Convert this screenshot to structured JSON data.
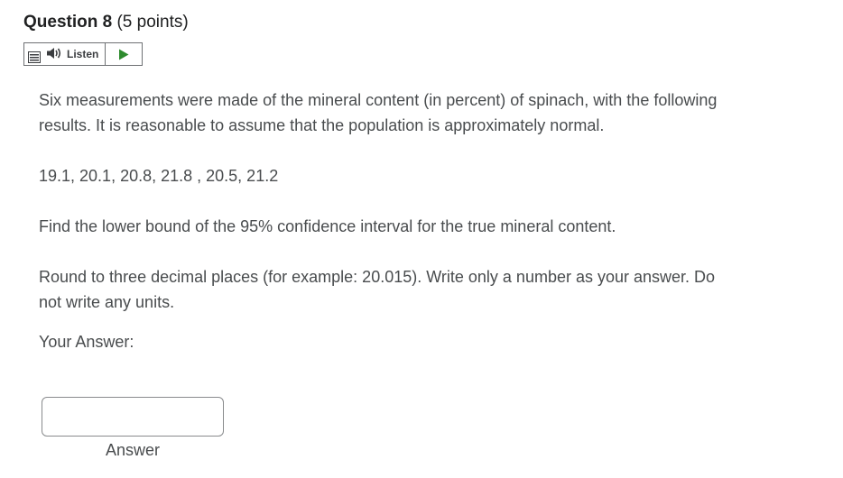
{
  "question": {
    "title": "Question 8",
    "points": "(5 points)"
  },
  "listen": {
    "label": "Listen",
    "icons": [
      "menu-icon",
      "speaker-icon",
      "play-icon"
    ],
    "play_color": "#2e8b2e"
  },
  "body": {
    "intro": "Six measurements were made of the mineral content (in percent) of spinach, with the following results. It is reasonable to assume that the population is approximately normal.",
    "data": "19.1, 20.1, 20.8, 21.8 , 20.5, 21.2",
    "find": "Find the lower bound of the 95% confidence interval for the true mineral content.",
    "round": "Round to three decimal places (for example: 20.015). Write only a number as your answer. Do not write any units.",
    "your_answer": "Your Answer:"
  },
  "answer": {
    "value": "",
    "label": "Answer"
  }
}
